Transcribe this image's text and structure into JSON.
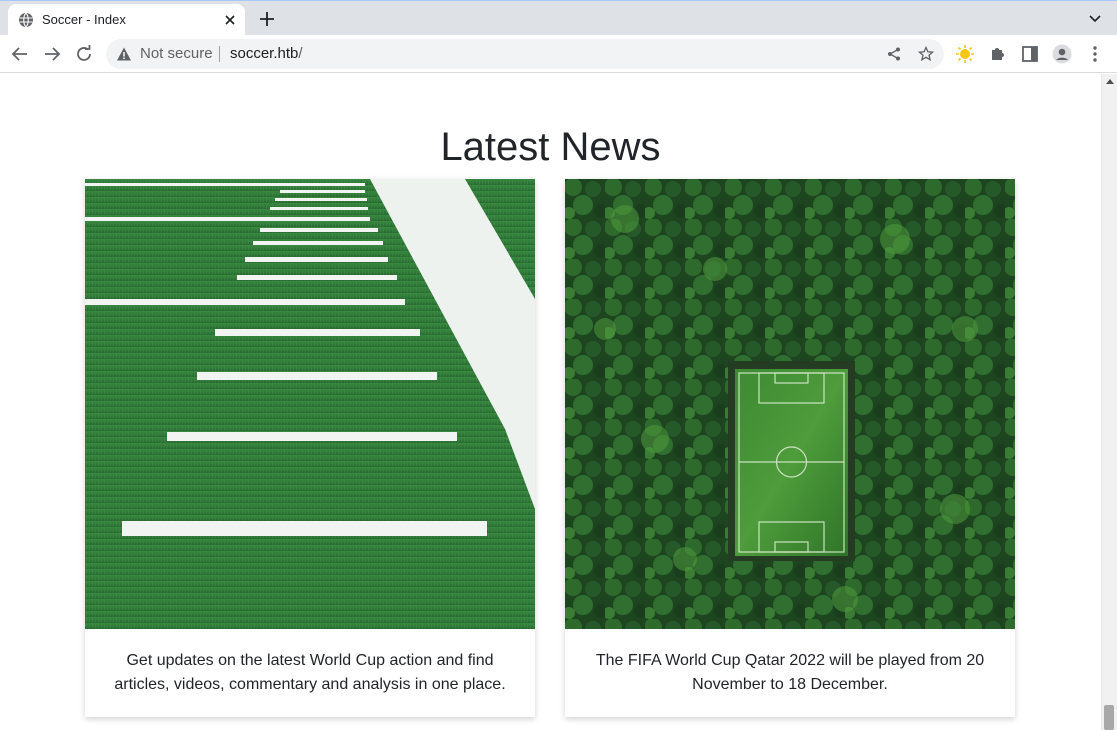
{
  "browser": {
    "tab_title": "Soccer - Index",
    "omnibox": {
      "security_label": "Not secure",
      "url_host": "soccer.htb",
      "url_path": "/"
    }
  },
  "page": {
    "section_title": "Latest News",
    "cards": [
      {
        "image_name": "football-field-yard-lines-photo",
        "text": "Get updates on the latest World Cup action and find articles, videos, commentary and analysis in one place."
      },
      {
        "image_name": "aerial-soccer-pitch-in-forest-photo",
        "text": "The FIFA World Cup Qatar 2022 will be played from 20 November to 18 December."
      }
    ]
  },
  "colors": {
    "grass": "#2f7a3a",
    "forest": "#1f4a22",
    "text": "#212529",
    "chrome": "#dee1e6"
  }
}
